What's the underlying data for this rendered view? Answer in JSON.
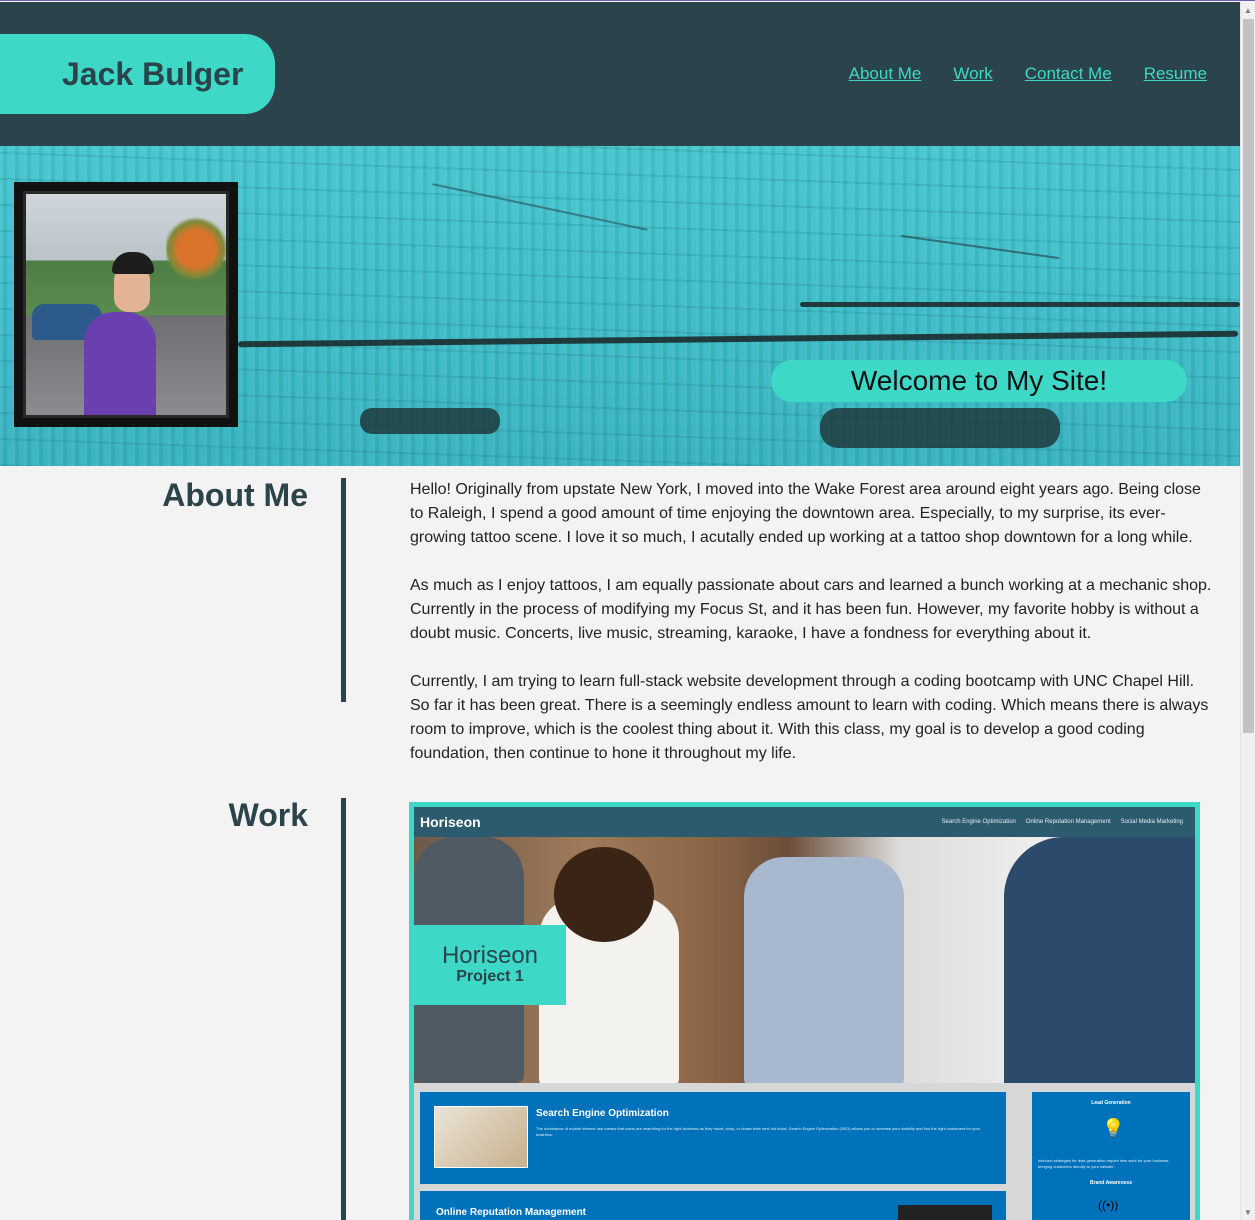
{
  "header": {
    "brand": "Jack Bulger",
    "nav": [
      "About Me",
      "Work",
      "Contact Me",
      "Resume"
    ]
  },
  "hero": {
    "welcome": "Welcome to My Site!"
  },
  "about": {
    "title": "About Me",
    "paragraphs": [
      "Hello! Originally from upstate New York, I moved into the Wake Forest area around eight years ago. Being close to Raleigh, I spend a good amount of time enjoying the downtown area. Especially, to my surprise, its ever-growing tattoo scene. I love it so much, I acutally ended up working at a tattoo shop downtown for a long while.",
      "As much as I enjoy tattoos, I am equally passionate about cars and learned a bunch working at a mechanic shop. Currently in the process of modifying my Focus St, and it has been fun. However, my favorite hobby is without a doubt music. Concerts, live music, streaming, karaoke, I have a fondness for everything about it.",
      "Currently, I am trying to learn full-stack website development through a coding bootcamp with UNC Chapel Hill. So far it has been great. There is a seemingly endless amount to learn with coding. Which means there is always room to improve, which is the coolest thing about it. With this class, my goal is to develop a good coding foundation, then continue to hone it throughout my life."
    ]
  },
  "work": {
    "title": "Work",
    "project": {
      "logo": "Horiseon",
      "nav": [
        "Search Engine Optimization",
        "Online Reputation Management",
        "Social Media Marketing"
      ],
      "badge_title": "Horiseon",
      "badge_subtitle": "Project 1",
      "seo_title": "Search Engine Optimization",
      "seo_body": "The dominance of mobile Internet use means that users are searching for the right business as they travel, shop, or chase their next hot ticket. Search Engine Optimization (SEO) allows you to increase your visibility and find the right customers for your business.",
      "orm_title": "Online Reputation Management",
      "side_title": "Lead Generation",
      "side_body": "Inbound strategies for lead generation require less work for your business, bringing customers directly to your website.",
      "side_title2": "Brand Awareness"
    }
  },
  "colors": {
    "accent": "#3dd9c6",
    "header_bg": "#2b434b",
    "page_bg": "#f3f3f3",
    "project_blue": "#0072bc"
  },
  "icons": [
    "lightbulb-icon",
    "broadcast-icon",
    "scroll-up-arrow-icon",
    "scroll-down-arrow-icon"
  ]
}
